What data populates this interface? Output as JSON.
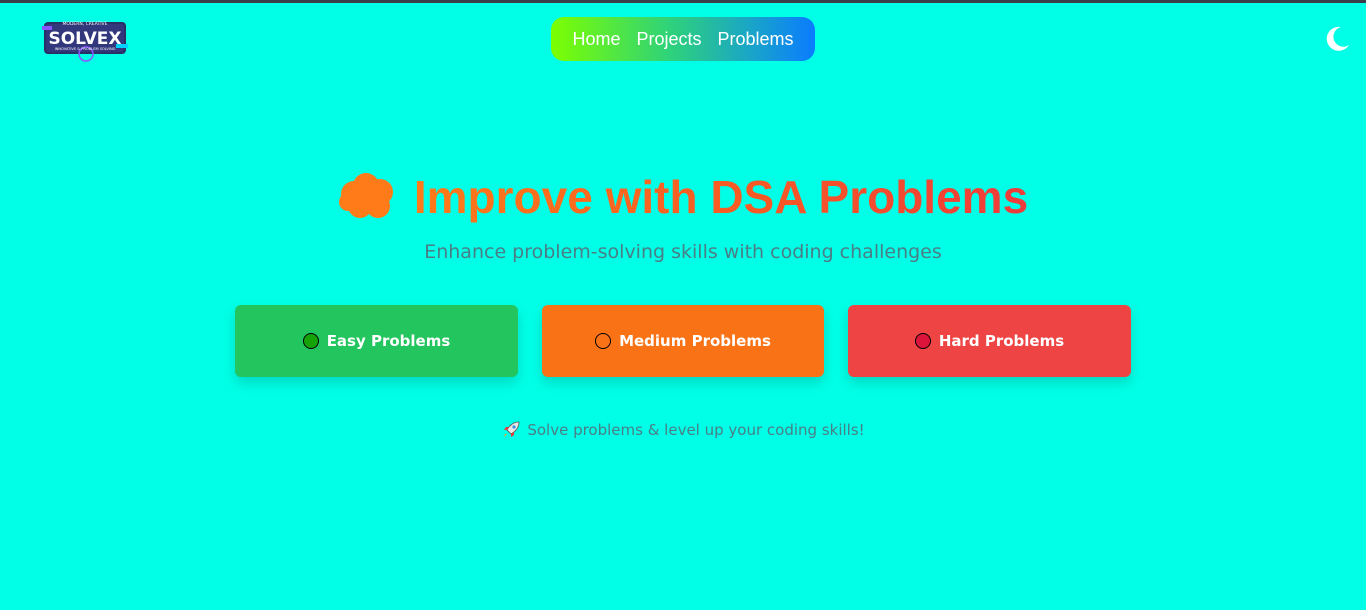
{
  "logo": {
    "text": "SOLVEX",
    "tagline_top": "MODERN, CREATIVE",
    "tagline_bottom": "INNOVATIVE & PROBLEM SOLVING",
    "icon": "solvex-logo"
  },
  "nav": {
    "items": [
      {
        "label": "Home"
      },
      {
        "label": "Projects"
      },
      {
        "label": "Problems"
      }
    ],
    "gradient": [
      "#7cff00",
      "#0a7cff"
    ]
  },
  "theme_toggle": {
    "icon": "moon-icon"
  },
  "hero": {
    "icon": "brain-icon",
    "title": "Improve with DSA Problems",
    "subtitle": "Enhance problem-solving skills with coding challenges"
  },
  "buttons": [
    {
      "label": "Easy Problems",
      "color": "#22c55e",
      "dot_color": "#16a30a",
      "icon": "green-circle-icon"
    },
    {
      "label": "Medium Problems",
      "color": "#f97316",
      "dot_color": "#f97316",
      "icon": "orange-circle-icon"
    },
    {
      "label": "Hard Problems",
      "color": "#ef4444",
      "dot_color": "#dc143c",
      "icon": "red-circle-icon"
    }
  ],
  "footer": {
    "icon": "rocket-icon",
    "text": "Solve problems & level up your coding skills!"
  },
  "colors": {
    "background": "#00ffe6",
    "title_gradient": [
      "#ff7a18",
      "#ee3b3b"
    ],
    "muted_text": "#4a7e86"
  }
}
